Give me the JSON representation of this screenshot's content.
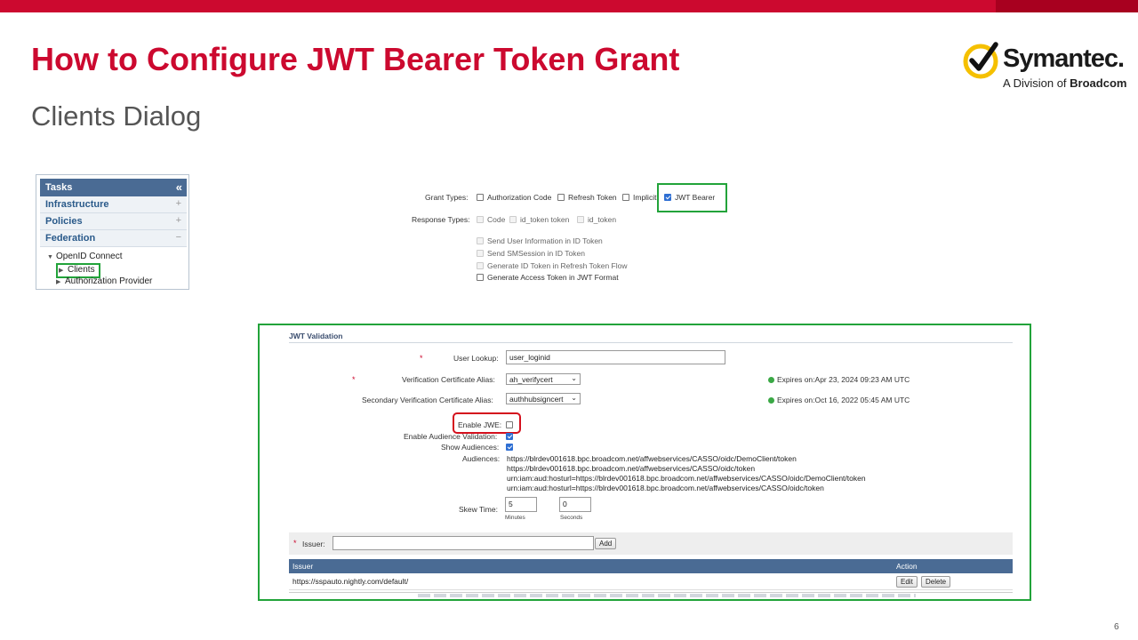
{
  "slide": {
    "title": "How to Configure JWT Bearer Token Grant",
    "subtitle": "Clients Dialog",
    "page_number": "6"
  },
  "logo": {
    "name": "Symantec.",
    "division_prefix": "A Division of ",
    "division_name": "Broadcom"
  },
  "tasks_panel": {
    "header": "Tasks",
    "collapse_glyph": "«",
    "sections": [
      {
        "label": "Infrastructure",
        "toggle": "+"
      },
      {
        "label": "Policies",
        "toggle": "+"
      },
      {
        "label": "Federation",
        "toggle": "−"
      }
    ],
    "tree": {
      "parent": "OpenID Connect",
      "children": [
        "Clients",
        "Authorization Provider"
      ]
    }
  },
  "grant_types": {
    "label": "Grant Types:",
    "options": [
      {
        "label": "Authorization Code",
        "checked": false
      },
      {
        "label": "Refresh Token",
        "checked": false
      },
      {
        "label": "Implicit",
        "checked": false
      },
      {
        "label": "JWT Bearer",
        "checked": true
      }
    ]
  },
  "response_types": {
    "label": "Response Types:",
    "options": [
      {
        "label": "Code",
        "enabled": false
      },
      {
        "label": "id_token token",
        "enabled": false
      },
      {
        "label": "id_token",
        "enabled": false
      }
    ]
  },
  "token_options": [
    {
      "label": "Send User Information in ID Token",
      "enabled": false
    },
    {
      "label": "Send SMSession in ID Token",
      "enabled": false
    },
    {
      "label": "Generate ID Token in Refresh Token Flow",
      "enabled": false
    },
    {
      "label": "Generate Access Token in JWT Format",
      "enabled": true
    }
  ],
  "jwt_validation": {
    "title": "JWT Validation",
    "required_marker": "*",
    "user_lookup": {
      "label": "User Lookup:",
      "value": "user_loginid"
    },
    "verification_cert": {
      "label": "Verification Certificate Alias:",
      "value": "ah_verifycert",
      "expires": "Expires on:Apr 23, 2024 09:23 AM UTC"
    },
    "secondary_cert": {
      "label": "Secondary Verification Certificate Alias:",
      "value": "authhubsigncert",
      "expires": "Expires on:Oct 16, 2022 05:45 AM UTC"
    },
    "enable_jwe": {
      "label": "Enable JWE:",
      "checked": false
    },
    "enable_audience_validation": {
      "label": "Enable Audience Validation:",
      "checked": true
    },
    "show_audiences": {
      "label": "Show Audiences:",
      "checked": true
    },
    "audiences": {
      "label": "Audiences:",
      "values": [
        "https://blrdev001618.bpc.broadcom.net/affwebservices/CASSO/oidc/DemoClient/token",
        "https://blrdev001618.bpc.broadcom.net/affwebservices/CASSO/oidc/token",
        "urn:iam:aud:hosturl=https://blrdev001618.bpc.broadcom.net/affwebservices/CASSO/oidc/DemoClient/token",
        "urn:iam:aud:hosturl=https://blrdev001618.bpc.broadcom.net/affwebservices/CASSO/oidc/token"
      ]
    },
    "skew_time": {
      "label": "Skew Time:",
      "minutes": "5",
      "seconds": "0",
      "minutes_label": "Minutes",
      "seconds_label": "Seconds"
    },
    "issuer": {
      "label": "Issuer:",
      "value": "",
      "add_button": "Add"
    },
    "issuer_table": {
      "columns": [
        "Issuer",
        "Action"
      ],
      "rows": [
        {
          "issuer": "https://sspauto.nightly.com/default/",
          "edit": "Edit",
          "delete": "Delete"
        }
      ]
    }
  },
  "colors": {
    "brand_red": "#cc092f",
    "highlight_green": "#22a33a",
    "highlight_red": "#d4101d",
    "header_blue": "#4a6b94"
  }
}
